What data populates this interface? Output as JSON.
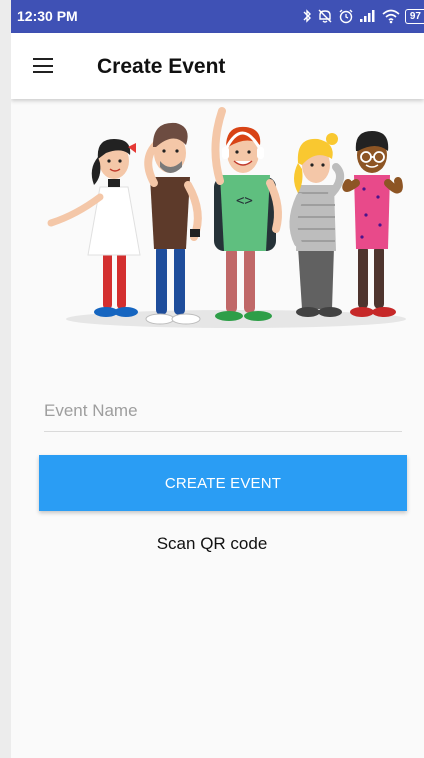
{
  "status_bar": {
    "time": "12:30 PM",
    "battery_level": "97",
    "icons": [
      "bluetooth-icon",
      "mute-icon",
      "alarm-icon",
      "signal-icon",
      "wifi-icon",
      "battery-icon"
    ]
  },
  "app_bar": {
    "title": "Create Event",
    "menu_icon": "hamburger-menu-icon"
  },
  "form": {
    "event_name": {
      "placeholder": "Event Name",
      "value": ""
    },
    "create_button_label": "CREATE EVENT",
    "scan_label": "Scan QR code"
  },
  "colors": {
    "status_bar": "#3f51b5",
    "primary_button": "#2a9df4",
    "background": "#fafafa"
  }
}
